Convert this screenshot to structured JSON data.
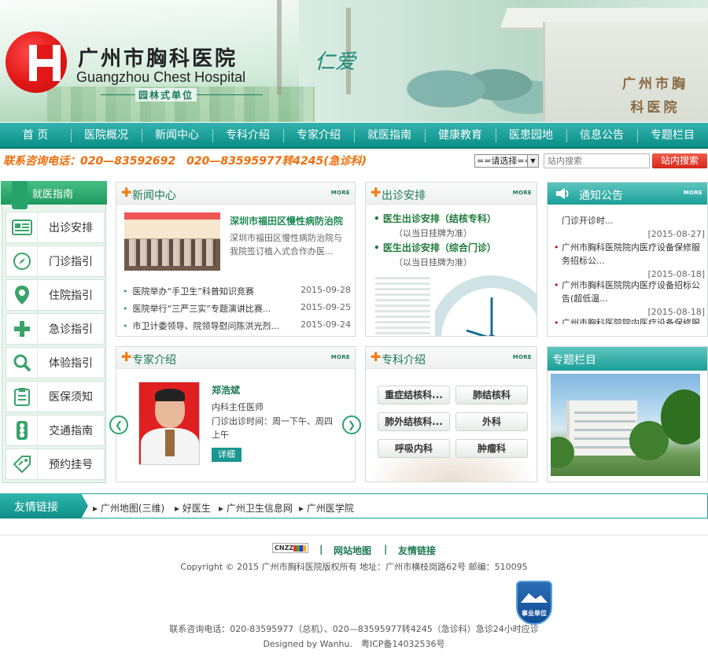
{
  "header": {
    "name_cn": "广州市胸科医院",
    "name_en": "Guangzhou Chest Hospital",
    "tagline": "园林式单位",
    "slogan": "仁爱",
    "building_sign": "广州市胸科医院"
  },
  "nav": [
    "首 页",
    "医院概况",
    "新闻中心",
    "专科介绍",
    "专家介绍",
    "就医指南",
    "健康教育",
    "医患园地",
    "信息公告",
    "专题栏目"
  ],
  "hotline": "联系咨询电话：020—83592692　020—83595977转4245(急诊科)",
  "search": {
    "select_value": "==请选择==",
    "placeholder": "站内搜索",
    "button": "站内搜索"
  },
  "sidebar": {
    "title": "就医指南",
    "items": [
      {
        "label": "出诊安排",
        "icon": "schedule-icon"
      },
      {
        "label": "门诊指引",
        "icon": "compass-icon"
      },
      {
        "label": "住院指引",
        "icon": "location-pin-icon"
      },
      {
        "label": "急诊指引",
        "icon": "cross-icon"
      },
      {
        "label": "体验指引",
        "icon": "magnifier-icon"
      },
      {
        "label": "医保须知",
        "icon": "clipboard-icon"
      },
      {
        "label": "交通指南",
        "icon": "traffic-light-icon"
      },
      {
        "label": "预约挂号",
        "icon": "tag-icon"
      }
    ]
  },
  "more_label": "MORE",
  "news": {
    "title": "新闻中心",
    "featured_title": "深圳市福田区慢性病防治院",
    "featured_desc": "深圳市福田区慢性病防治院与我院签订植入式合作办医...",
    "items": [
      {
        "text": "医院举办“手卫生”科普知识竞赛",
        "date": "2015-09-28"
      },
      {
        "text": "医院举行“三严三实”专题演讲比赛...",
        "date": "2015-09-25"
      },
      {
        "text": "市卫计委领导、院领导慰问陈洪光烈...",
        "date": "2015-09-24"
      }
    ]
  },
  "clinic": {
    "title": "出诊安排",
    "items": [
      {
        "text": "医生出诊安排（结核专科）",
        "sub": "（以当日挂牌为准）"
      },
      {
        "text": "医生出诊安排（综合门诊）",
        "sub": "（以当日挂牌为准）"
      }
    ]
  },
  "notice": {
    "title": "通知公告",
    "items": [
      {
        "text": "门诊开诊时...",
        "date": "[2015-08-27]"
      },
      {
        "text": "广州市胸科医院院内医疗设备保修服务招标公...",
        "date": "[2015-08-18]"
      },
      {
        "text": "广州市胸科医院院内医疗设备招标公告(超低温...",
        "date": "[2015-08-18]"
      },
      {
        "text": "广州市胸科医院院内医疗设备保修服"
      }
    ]
  },
  "expert": {
    "title": "专家介绍",
    "name": "郑浩斌",
    "role": "内科主任医师",
    "hours": "门诊出诊时间：周一下午、周四上午",
    "detail_button": "详细"
  },
  "dept": {
    "title": "专科介绍",
    "items": [
      "重症结核科...",
      "肺结核科",
      "肺外结核科...",
      "外科",
      "呼吸内科",
      "肿瘤科"
    ]
  },
  "feature": {
    "title": "专题栏目"
  },
  "links": {
    "title": "友情链接",
    "items": [
      "广州地图(三维)",
      "好医生",
      "广州卫生信息网",
      "广州医学院"
    ]
  },
  "footer": {
    "cnzz": "CNZZ",
    "sitemap": "网站地图",
    "friend_links": "友情链接",
    "copyright": "Copyright © 2015 广州市胸科医院版权所有 地址：广州市横枝岗路62号 邮编：510095",
    "badge": "事业单位",
    "contact": "联系咨询电话：020-83595977（总机）、020—83595977转4245（急诊科）急诊24小时应诊",
    "designed": "Designed by Wanhu.　粤ICP备14032536号"
  },
  "colors": {
    "nav": "#0c8f88",
    "accent_orange": "#f16d0a",
    "green_text": "#1b7a55",
    "logo_red": "#e21818"
  }
}
